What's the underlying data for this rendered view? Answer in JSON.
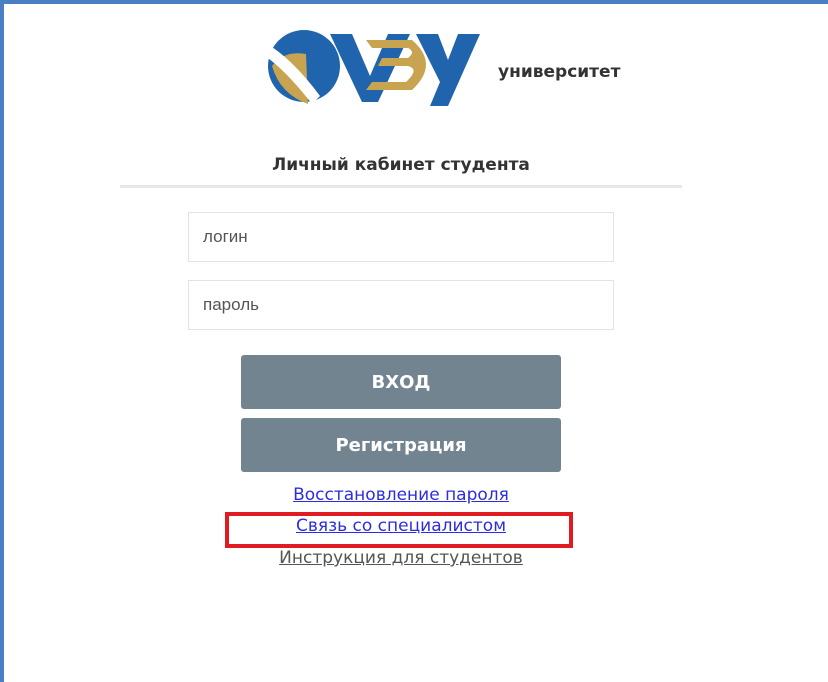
{
  "logo": {
    "icon": "university-logo-icon",
    "text": "университет"
  },
  "cabinet_title": "Личный кабинет студента",
  "login_field": {
    "placeholder": "логин",
    "value": ""
  },
  "password_field": {
    "placeholder": "пароль",
    "value": ""
  },
  "buttons": {
    "login": "ВХОД",
    "register": "Регистрация"
  },
  "links": {
    "restore_password": "Восстановление пароля",
    "contact_specialist": "Связь со специалистом",
    "instruction": "Инструкция для студентов"
  },
  "colors": {
    "frame": "#4a7fc4",
    "button": "#738491",
    "link": "#2d2de0",
    "highlight": "#e01b22",
    "logo_blue": "#1f64ad",
    "logo_gold": "#c8a350"
  }
}
